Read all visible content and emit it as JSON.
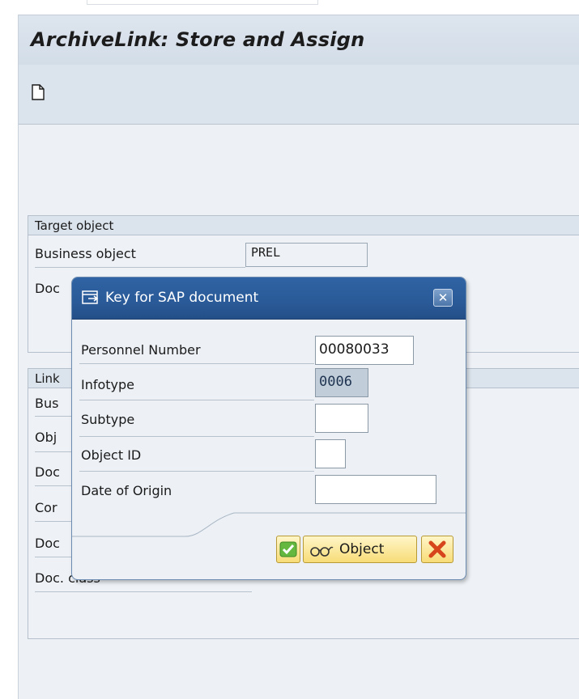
{
  "window": {
    "title": "ArchiveLink: Store and Assign"
  },
  "toolbar": {
    "new_icon": "new-document-icon"
  },
  "target_group": {
    "header": "Target object",
    "business_object_label": "Business object",
    "business_object_value": "PREL",
    "doc_label_partial": "Doc"
  },
  "link_group": {
    "header_partial": "Link",
    "rows": [
      "Bus",
      "Obj",
      "Doc",
      "Cor",
      "Doc"
    ],
    "doc_class_label": "Doc. class"
  },
  "popup": {
    "title": "Key for SAP document",
    "close_icon": "close-icon",
    "fields": [
      {
        "label": "Personnel Number",
        "value": "00080033"
      },
      {
        "label": "Infotype",
        "value": "0006"
      },
      {
        "label": "Subtype",
        "value": ""
      },
      {
        "label": "Object ID",
        "value": ""
      },
      {
        "label": "Date of Origin",
        "value": ""
      }
    ],
    "buttons": {
      "object_label": "Object"
    },
    "colors": {
      "titlebar": "#2a5a98",
      "button_yellow": "#f7dc77",
      "ok_green": "#4aa82f",
      "cancel_red": "#d6451c"
    }
  }
}
